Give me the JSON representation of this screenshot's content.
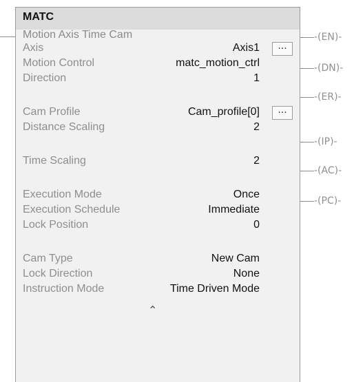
{
  "instruction": {
    "mnemonic": "MATC",
    "title": "Motion Axis Time Cam"
  },
  "params": {
    "axis": {
      "label": "Axis",
      "value": "Axis1"
    },
    "motion_control": {
      "label": "Motion Control",
      "value": "matc_motion_ctrl"
    },
    "direction": {
      "label": "Direction",
      "value": "1"
    },
    "cam_profile": {
      "label": "Cam Profile",
      "value": "Cam_profile[0]"
    },
    "distance_scaling": {
      "label": "Distance Scaling",
      "value": "2"
    },
    "time_scaling": {
      "label": "Time Scaling",
      "value": "2"
    },
    "execution_mode": {
      "label": "Execution Mode",
      "value": "Once"
    },
    "execution_schedule": {
      "label": "Execution Schedule",
      "value": "Immediate"
    },
    "lock_position": {
      "label": "Lock Position",
      "value": "0"
    },
    "cam_type": {
      "label": "Cam Type",
      "value": "New Cam"
    },
    "lock_direction": {
      "label": "Lock Direction",
      "value": "None"
    },
    "instruction_mode": {
      "label": "Instruction Mode",
      "value": "Time Driven Mode"
    }
  },
  "browse_label": "...",
  "outputs": {
    "en": "-(EN)-",
    "dn": "-(DN)-",
    "er": "-(ER)-",
    "ip": "-(IP)-",
    "ac": "-(AC)-",
    "pc": "-(PC)-"
  },
  "collapse_glyph": "⌃"
}
